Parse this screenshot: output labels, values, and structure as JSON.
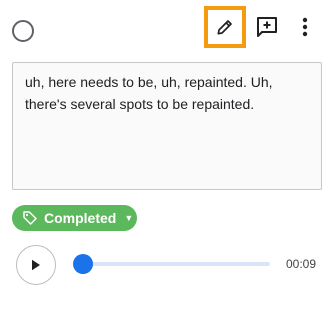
{
  "toolbar": {
    "status_circle_icon": "circle-outline-icon",
    "edit_icon": "pencil-icon",
    "comment_icon": "add-comment-icon",
    "more_icon": "more-vert-icon",
    "highlight_color": "#f39c12"
  },
  "note": {
    "text": "uh, here needs to be, uh, repainted. Uh, there's several spots to be repainted."
  },
  "status": {
    "label": "Completed",
    "icon": "tag-icon",
    "color": "#5cb85c"
  },
  "audio": {
    "play_icon": "play-icon",
    "progress": 0,
    "duration": "00:09",
    "accent_color": "#1a73e8"
  }
}
